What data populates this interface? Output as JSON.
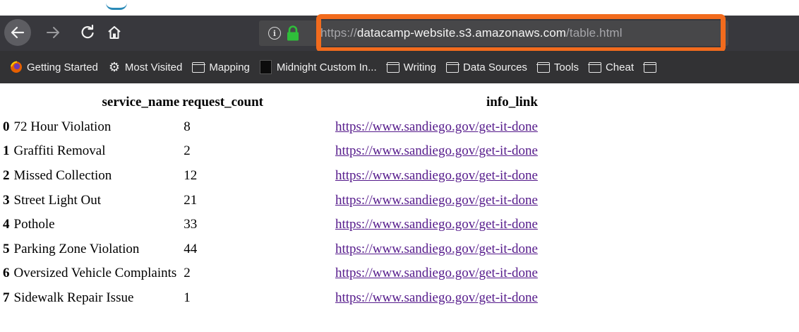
{
  "browser": {
    "url": {
      "scheme": "https://",
      "host": "datacamp-website.s3.amazonaws.com",
      "path": "/table.html"
    },
    "icons": {
      "back": "back-arrow-icon",
      "forward": "forward-arrow-icon",
      "reload": "reload-icon",
      "home": "home-icon",
      "info": "info-icon",
      "lock": "lock-icon"
    },
    "highlight_color": "#f26b1d",
    "lock_color": "#2fbe3a"
  },
  "bookmarks": [
    {
      "label": "Getting Started",
      "icon": "firefox-icon"
    },
    {
      "label": "Most Visited",
      "icon": "gear-icon"
    },
    {
      "label": "Mapping",
      "icon": "folder-icon"
    },
    {
      "label": "Midnight Custom In...",
      "icon": "page-icon"
    },
    {
      "label": "Writing",
      "icon": "folder-icon"
    },
    {
      "label": "Data Sources",
      "icon": "folder-icon"
    },
    {
      "label": "Tools",
      "icon": "folder-icon"
    },
    {
      "label": "Cheat",
      "icon": "folder-icon"
    }
  ],
  "table": {
    "headers": [
      "service_name",
      "request_count",
      "info_link"
    ],
    "rows": [
      {
        "index": "0",
        "service_name": "72 Hour Violation",
        "request_count": "8",
        "info_link": "https://www.sandiego.gov/get-it-done"
      },
      {
        "index": "1",
        "service_name": "Graffiti Removal",
        "request_count": "2",
        "info_link": "https://www.sandiego.gov/get-it-done"
      },
      {
        "index": "2",
        "service_name": "Missed Collection",
        "request_count": "12",
        "info_link": "https://www.sandiego.gov/get-it-done"
      },
      {
        "index": "3",
        "service_name": "Street Light Out",
        "request_count": "21",
        "info_link": "https://www.sandiego.gov/get-it-done"
      },
      {
        "index": "4",
        "service_name": "Pothole",
        "request_count": "33",
        "info_link": "https://www.sandiego.gov/get-it-done"
      },
      {
        "index": "5",
        "service_name": "Parking Zone Violation",
        "request_count": "44",
        "info_link": "https://www.sandiego.gov/get-it-done"
      },
      {
        "index": "6",
        "service_name": "Oversized Vehicle Complaints",
        "request_count": "2",
        "info_link": "https://www.sandiego.gov/get-it-done"
      },
      {
        "index": "7",
        "service_name": "Sidewalk Repair Issue",
        "request_count": "1",
        "info_link": "https://www.sandiego.gov/get-it-done"
      }
    ]
  }
}
